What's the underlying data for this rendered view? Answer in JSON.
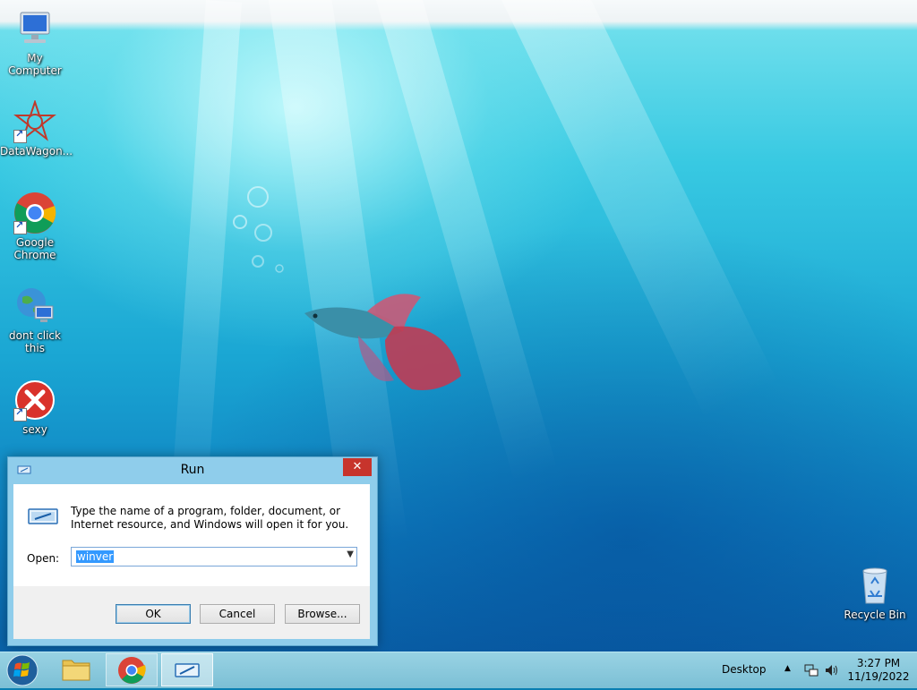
{
  "desktop": {
    "icons": [
      {
        "label": "My Computer"
      },
      {
        "label": "DataWagon..."
      },
      {
        "label": "Google Chrome"
      },
      {
        "label": "dont click this"
      },
      {
        "label": "sexy"
      }
    ],
    "recycle_bin_label": "Recycle Bin"
  },
  "run_dialog": {
    "title": "Run",
    "close_glyph": "✕",
    "description": "Type the name of a program, folder, document, or Internet resource, and Windows will open it for you.",
    "open_label": "Open:",
    "open_value": "winver",
    "ok_label": "OK",
    "cancel_label": "Cancel",
    "browse_label": "Browse..."
  },
  "taskbar": {
    "desktop_label": "Desktop",
    "time": "3:27 PM",
    "date": "11/19/2022"
  },
  "colors": {
    "close_button": "#c7342c",
    "dialog_frame": "#8fcdeb",
    "selection": "#3399ff"
  }
}
